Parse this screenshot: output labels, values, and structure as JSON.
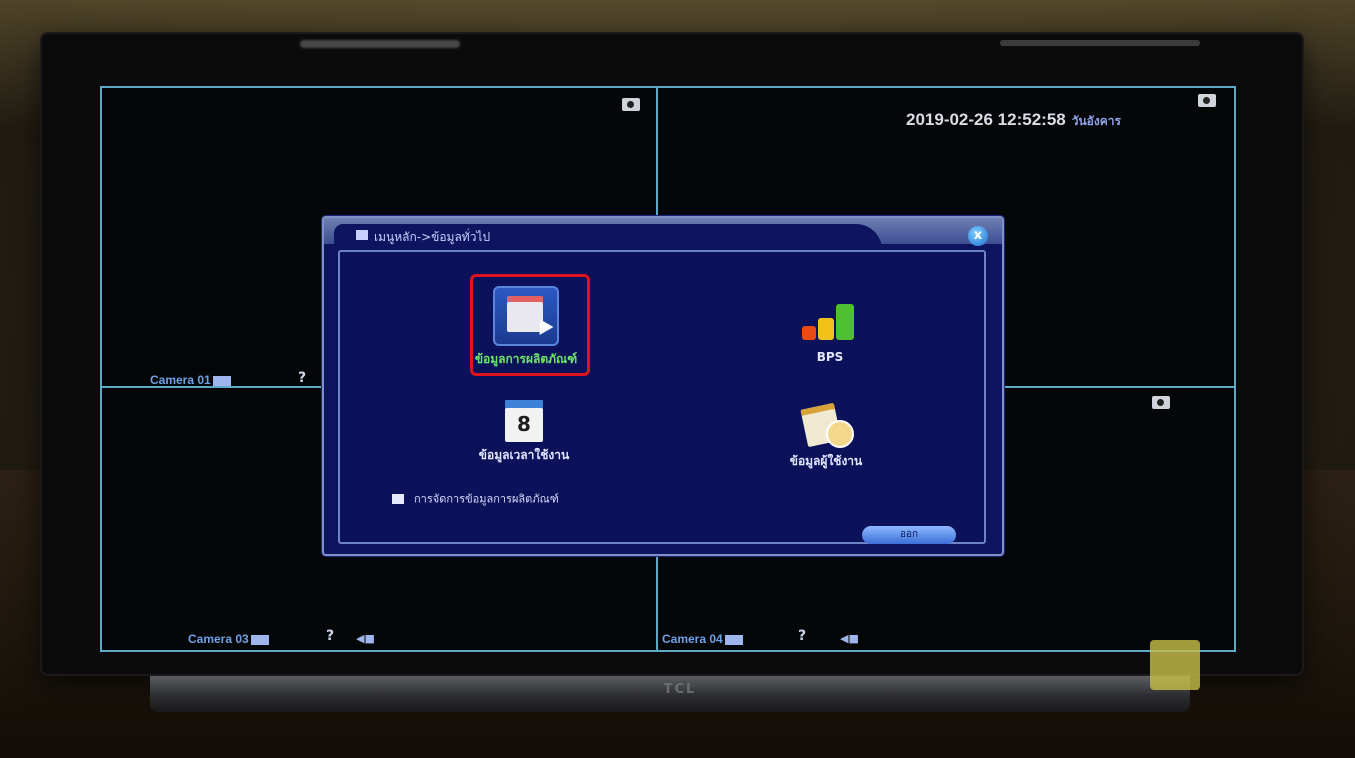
{
  "screen": {
    "datetime": "2019-02-26 12:52:58",
    "weekday": "วันอังคาร"
  },
  "cameras": [
    {
      "label": "Camera 01"
    },
    {
      "label": "Camera 03"
    },
    {
      "label": "Camera 04"
    }
  ],
  "dialog": {
    "title": "เมนูหลัก->ข้อมูลทั่วไป",
    "close_label": "x",
    "tiles": [
      {
        "label": "ข้อมูลการผลิตภัณฑ์",
        "icon": "info-icon"
      },
      {
        "label": "BPS",
        "icon": "bps-bar-icon"
      },
      {
        "label": "ข้อมูลเวลาใช้งาน",
        "icon": "calendar-icon",
        "day": "8"
      },
      {
        "label": "ข้อมูลผู้ใช้งาน",
        "icon": "user-info-icon"
      }
    ],
    "checkbox_label": "การจัดการข้อมูลการผลิตภัณฑ์",
    "ok_label": "ออก"
  },
  "tv": {
    "brand": "TCL"
  },
  "colors": {
    "grid_line": "#5fa9c8",
    "dialog_bg": "#0e1560",
    "highlight": "#e1121f",
    "selected_label": "#6ee36a"
  }
}
